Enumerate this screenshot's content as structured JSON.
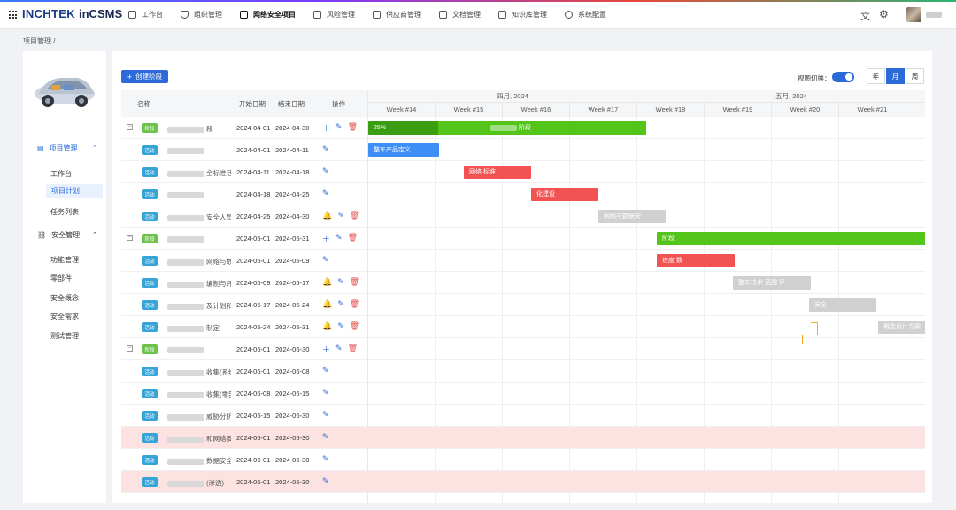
{
  "app": {
    "brand": "INCHTEK",
    "name": "inCSMS",
    "nav": [
      {
        "label": "工作台",
        "icon": "bank-icon"
      },
      {
        "label": "组织管理",
        "icon": "shield-icon"
      },
      {
        "label": "网络安全项目",
        "icon": "table-icon",
        "active": true
      },
      {
        "label": "风险管理",
        "icon": "mail-icon"
      },
      {
        "label": "供应商管理",
        "icon": "copy-icon"
      },
      {
        "label": "文档管理",
        "icon": "document-icon"
      },
      {
        "label": "知识库管理",
        "icon": "book-icon"
      },
      {
        "label": "系统配置",
        "icon": "gear-icon"
      }
    ]
  },
  "breadcrumb": "项目管理 /",
  "sidebar": {
    "group1": {
      "label": "项目管理",
      "items": [
        "工作台",
        "项目计划",
        "任务列表"
      ],
      "active": "项目计划"
    },
    "group2": {
      "label": "安全管理",
      "items": [
        "功能管理",
        "零部件",
        "安全概念",
        "安全需求",
        "测试管理"
      ]
    }
  },
  "toolbar": {
    "create_label": "创建阶段",
    "switch_label": "视图切换：",
    "segments": [
      "年",
      "月",
      "周"
    ],
    "active_segment": "月"
  },
  "table": {
    "headers": {
      "name": "名称",
      "start": "开始日期",
      "end": "结束日期",
      "ops": "操作"
    },
    "rows": [
      {
        "tag": "阶段",
        "type": "phase",
        "name": "段",
        "start": "2024-04-01",
        "end": "2024-04-30",
        "ops": "add-edit-del"
      },
      {
        "tag": "活动",
        "type": "act",
        "name": "",
        "start": "2024-04-01",
        "end": "2024-04-11",
        "ops": "edit"
      },
      {
        "tag": "活动",
        "type": "act",
        "name": "全标准活",
        "start": "2024-04-11",
        "end": "2024-04-18",
        "ops": "edit"
      },
      {
        "tag": "活动",
        "type": "act",
        "name": "",
        "start": "2024-04-18",
        "end": "2024-04-25",
        "ops": "edit"
      },
      {
        "tag": "活动",
        "type": "act",
        "name": "安全人员及",
        "start": "2024-04-25",
        "end": "2024-04-30",
        "ops": "bell-edit-del"
      },
      {
        "tag": "阶段",
        "type": "phase",
        "name": "",
        "start": "2024-05-01",
        "end": "2024-05-31",
        "ops": "add-edit-del"
      },
      {
        "tag": "活动",
        "type": "act",
        "name": "网络与数",
        "start": "2024-05-01",
        "end": "2024-05-09",
        "ops": "edit"
      },
      {
        "tag": "活动",
        "type": "act",
        "name": "编制与评",
        "start": "2024-05-09",
        "end": "2024-05-17",
        "ops": "bell-edit-del"
      },
      {
        "tag": "活动",
        "type": "act",
        "name": "及计划和",
        "start": "2024-05-17",
        "end": "2024-05-24",
        "ops": "bell-edit-del"
      },
      {
        "tag": "活动",
        "type": "act",
        "name": "制定",
        "start": "2024-05-24",
        "end": "2024-05-31",
        "ops": "bell-edit-del"
      },
      {
        "tag": "阶段",
        "type": "phase",
        "name": "",
        "start": "2024-06-01",
        "end": "2024-06-30",
        "ops": "add-edit-del"
      },
      {
        "tag": "活动",
        "type": "act",
        "name": "收集(系统",
        "start": "2024-06-01",
        "end": "2024-06-08",
        "ops": "edit"
      },
      {
        "tag": "活动",
        "type": "act",
        "name": "收集(零部",
        "start": "2024-06-08",
        "end": "2024-06-15",
        "ops": "edit"
      },
      {
        "tag": "活动",
        "type": "act",
        "name": "威胁分析",
        "start": "2024-06-15",
        "end": "2024-06-30",
        "ops": "edit"
      },
      {
        "tag": "活动",
        "type": "act",
        "name": "和网络安",
        "start": "2024-06-01",
        "end": "2024-06-30",
        "ops": "edit",
        "highlight": true
      },
      {
        "tag": "活动",
        "type": "act",
        "name": "数据安全",
        "start": "2024-06-01",
        "end": "2024-06-30",
        "ops": "edit"
      },
      {
        "tag": "活动",
        "type": "act",
        "name": "(渗透)",
        "start": "2024-06-01",
        "end": "2024-06-30",
        "ops": "edit",
        "highlight": true
      }
    ]
  },
  "gantt": {
    "months": [
      "四月, 2024",
      "五月, 2024"
    ],
    "weeks": [
      "Week #14",
      "Week #15",
      "Week #16",
      "Week #17",
      "Week #18",
      "Week #19",
      "Week #20",
      "Week #21",
      "W"
    ],
    "bars": [
      {
        "row": 0,
        "color": "green",
        "label": "阶段",
        "progress": 0.25,
        "progress_label": "25%"
      },
      {
        "row": 1,
        "color": "blue",
        "label": "整车产品定义"
      },
      {
        "row": 2,
        "color": "red",
        "label": "网络 标准"
      },
      {
        "row": 3,
        "color": "red",
        "label": "化建设"
      },
      {
        "row": 4,
        "color": "gray",
        "label": "网络与数据安"
      },
      {
        "row": 5,
        "color": "green",
        "label": "阶段"
      },
      {
        "row": 6,
        "color": "red",
        "label": "进度 数"
      },
      {
        "row": 7,
        "color": "gray",
        "label": "整车技术 范围 评"
      },
      {
        "row": 8,
        "color": "gray",
        "label": "安全"
      },
      {
        "row": 9,
        "color": "gray",
        "label": "概念设计方案"
      }
    ]
  }
}
